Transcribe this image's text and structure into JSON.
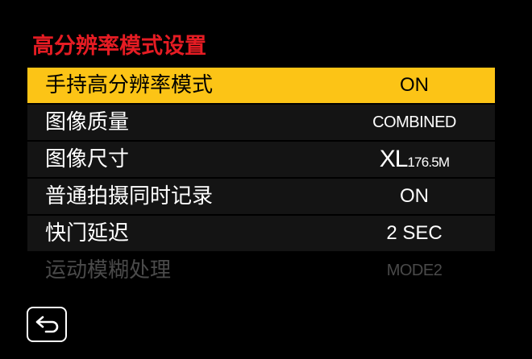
{
  "title": "高分辨率模式设置",
  "menu": {
    "items": [
      {
        "label": "手持高分辨率模式",
        "value": "ON",
        "selected": true
      },
      {
        "label": "图像质量",
        "value": "COMBINED"
      },
      {
        "label": "图像尺寸",
        "value_main": "XL",
        "value_sub": "176.5M"
      },
      {
        "label": "普通拍摄同时记录",
        "value": "ON"
      },
      {
        "label": "快门延迟",
        "value": "2 SEC"
      },
      {
        "label": "运动模糊处理",
        "value": "MODE2",
        "disabled": true
      }
    ]
  },
  "back_button": {
    "icon": "return-arrow-icon"
  },
  "colors": {
    "title": "#e51c23",
    "highlight": "#fcc416",
    "row_bg": "#141414",
    "disabled_text": "#4a4a4a"
  }
}
